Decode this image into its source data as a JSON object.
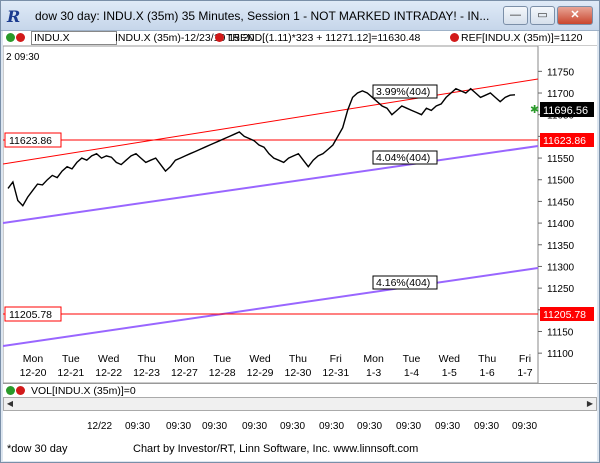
{
  "window": {
    "app_glyph": "R",
    "title": "dow 30 day: INDU.X (35m) 35 Minutes, Session 1 - NOT MARKED INTRADAY! - IN...",
    "minimize": "—",
    "maximize": "▭",
    "close": "✕"
  },
  "toolbar": {
    "symbol": "INDU.X",
    "trend": "INDU.X (35m)-12/23/10 15:20",
    "trend_formula": "TREND[(1.11)*323 + 11271.12]=11630.48",
    "ref": "REF[INDU.X (35m)]=1120"
  },
  "chart": {
    "corner_label": "2 09:30",
    "last_price": "11696.56",
    "ref_high": "11623.86",
    "ref_low": "11205.78",
    "channel_top_label": "3.99%(404)",
    "channel_mid_label": "4.04%(404)",
    "channel_low_label": "4.16%(404)",
    "colors": {
      "price": "#000000",
      "red": "#ff0000",
      "purple": "#9966ff",
      "last_label_bg": "#000000"
    }
  },
  "chart_data": {
    "type": "line",
    "y_ticks": [
      "11750",
      "11700",
      "11650",
      "11600",
      "11550",
      "11500",
      "11450",
      "11400",
      "11350",
      "11300",
      "11250",
      "11200",
      "11150",
      "11100"
    ],
    "ylim": [
      11075,
      11790
    ],
    "days": [
      {
        "dow": "Mon",
        "date": "12-20"
      },
      {
        "dow": "Tue",
        "date": "12-21"
      },
      {
        "dow": "Wed",
        "date": "12-22"
      },
      {
        "dow": "Thu",
        "date": "12-23"
      },
      {
        "dow": "Mon",
        "date": "12-27"
      },
      {
        "dow": "Tue",
        "date": "12-28"
      },
      {
        "dow": "Wed",
        "date": "12-29"
      },
      {
        "dow": "Thu",
        "date": "12-30"
      },
      {
        "dow": "Fri",
        "date": "12-31"
      },
      {
        "dow": "Mon",
        "date": "1-3"
      },
      {
        "dow": "Tue",
        "date": "1-4"
      },
      {
        "dow": "Wed",
        "date": "1-5"
      },
      {
        "dow": "Thu",
        "date": "1-6"
      },
      {
        "dow": "Fri",
        "date": "1-7"
      }
    ],
    "series": [
      {
        "values": [
          11480,
          11495,
          11452,
          11440,
          11460,
          11475,
          11490,
          11488,
          11500,
          11510,
          11505,
          11520,
          11530,
          11525,
          11540,
          11550,
          11545,
          11555,
          11560,
          11550,
          11555,
          11552,
          11540,
          11535,
          11545,
          11555,
          11560,
          11550,
          11540,
          11545,
          11550,
          11535,
          11520,
          11530,
          11545,
          11550,
          11555,
          11560,
          11565,
          11570,
          11575,
          11580,
          11585,
          11590,
          11595,
          11600,
          11605,
          11610,
          11600,
          11595,
          11590,
          11580,
          11575,
          11560,
          11550,
          11545,
          11540,
          11550,
          11555,
          11560,
          11545,
          11530,
          11545,
          11555,
          11560,
          11570,
          11580,
          11600,
          11620,
          11660,
          11690,
          11700,
          11705,
          11700,
          11690,
          11680,
          11670,
          11665,
          11650,
          11660,
          11670,
          11665,
          11660,
          11655,
          11650,
          11665,
          11660,
          11670,
          11675,
          11690,
          11700,
          11710,
          11705,
          11700,
          11710,
          11700,
          11690,
          11695,
          11700,
          11690,
          11680,
          11690,
          11695,
          11696
        ]
      }
    ]
  },
  "volume": {
    "label": "VOL[INDU.X (35m)]=0"
  },
  "time_axis": {
    "first_date": "12/22",
    "labels": [
      "09:30",
      "09:30",
      "09:30",
      "09:30",
      "09:30",
      "09:30",
      "09:30",
      "09:30",
      "09:30",
      "09:30",
      "09:30",
      "09:30",
      "09:30"
    ]
  },
  "status": {
    "tab": "*dow 30 day",
    "credit": "Chart by Investor/RT, Linn Software, Inc. www.linnsoft.com"
  }
}
